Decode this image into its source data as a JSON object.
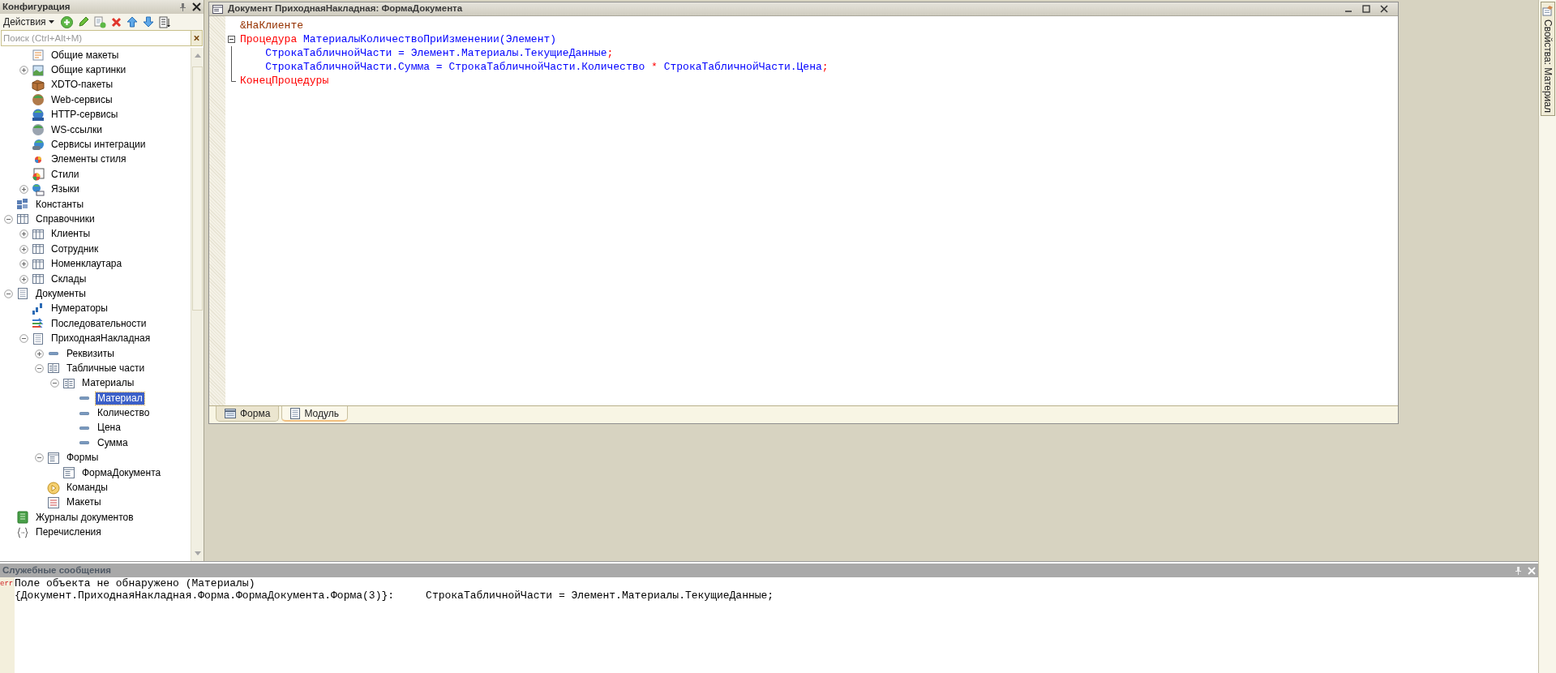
{
  "config_panel": {
    "title": "Конфигурация",
    "actions_menu": "Действия",
    "search": {
      "placeholder": "Поиск (Ctrl+Alt+M)"
    },
    "tree": {
      "continued": [
        {
          "label": "Общие макеты",
          "kind": "layouts",
          "selected": false
        },
        {
          "label": "Общие картинки",
          "kind": "pictures",
          "selected": false,
          "expanded": false
        },
        {
          "label": "XDTO-пакеты",
          "kind": "xdto",
          "selected": false
        },
        {
          "label": "Web-сервисы",
          "kind": "web",
          "selected": false
        },
        {
          "label": "HTTP-сервисы",
          "kind": "http",
          "selected": false
        },
        {
          "label": "WS-ссылки",
          "kind": "ws",
          "selected": false
        },
        {
          "label": "Сервисы интеграции",
          "kind": "integration",
          "selected": false
        },
        {
          "label": "Элементы стиля",
          "kind": "style-items",
          "selected": false
        },
        {
          "label": "Стили",
          "kind": "styles",
          "selected": false
        },
        {
          "label": "Языки",
          "kind": "languages",
          "selected": false,
          "expanded": false
        }
      ],
      "items": [
        {
          "label": "Константы",
          "kind": "constants",
          "selected": false
        },
        {
          "label": "Справочники",
          "kind": "catalogs",
          "selected": false,
          "expanded": true,
          "children": [
            {
              "label": "Клиенты",
              "kind": "catalog",
              "selected": false,
              "expanded": false
            },
            {
              "label": "Сотрудник",
              "kind": "catalog",
              "selected": false,
              "expanded": false
            },
            {
              "label": "Номенклаутара",
              "kind": "catalog",
              "selected": false,
              "expanded": false
            },
            {
              "label": "Склады",
              "kind": "catalog",
              "selected": false,
              "expanded": false
            }
          ]
        },
        {
          "label": "Документы",
          "kind": "documents",
          "selected": false,
          "expanded": true,
          "children": [
            {
              "label": "Нумераторы",
              "kind": "numerators",
              "selected": false
            },
            {
              "label": "Последовательности",
              "kind": "sequences",
              "selected": false
            },
            {
              "label": "ПриходнаяНакладная",
              "kind": "document",
              "selected": false,
              "expanded": true,
              "children": [
                {
                  "label": "Реквизиты",
                  "kind": "attributes",
                  "selected": false,
                  "expanded": false
                },
                {
                  "label": "Табличные части",
                  "kind": "tabular-sections",
                  "selected": false,
                  "expanded": true,
                  "children": [
                    {
                      "label": "Материалы",
                      "kind": "tabular-section",
                      "selected": false,
                      "expanded": true,
                      "children": [
                        {
                          "label": "Материал",
                          "kind": "attribute",
                          "selected": true
                        },
                        {
                          "label": "Количество",
                          "kind": "attribute",
                          "selected": false
                        },
                        {
                          "label": "Цена",
                          "kind": "attribute",
                          "selected": false
                        },
                        {
                          "label": "Сумма",
                          "kind": "attribute",
                          "selected": false
                        }
                      ]
                    }
                  ]
                },
                {
                  "label": "Формы",
                  "kind": "forms",
                  "selected": false,
                  "expanded": true,
                  "children": [
                    {
                      "label": "ФормаДокумента",
                      "kind": "form",
                      "selected": false
                    }
                  ]
                },
                {
                  "label": "Команды",
                  "kind": "commands",
                  "selected": false
                },
                {
                  "label": "Макеты",
                  "kind": "templates",
                  "selected": false
                }
              ]
            }
          ]
        },
        {
          "label": "Журналы документов",
          "kind": "journals",
          "selected": false
        },
        {
          "label": "Перечисления",
          "kind": "enums",
          "selected": false
        }
      ]
    }
  },
  "editor": {
    "title": "Документ ПриходнаяНакладная: ФормаДокумента",
    "code_lines": [
      {
        "kind": "line",
        "tokens": [
          {
            "kind": "directive",
            "text": "&НаКлиенте"
          }
        ]
      },
      {
        "kind": "block",
        "expanded": true,
        "lines": [
          {
            "tokens": [
              {
                "kind": "keyword",
                "text": "Процедура"
              },
              {
                "kind": "ident",
                "text": " МатериалыКоличествоПриИзменении(Элемент)"
              }
            ]
          },
          {
            "tokens": [
              {
                "kind": "ident",
                "text": "    СтрокаТабличнойЧасти = Элемент.Материалы.ТекущиеДанные"
              },
              {
                "kind": "operator",
                "text": ";"
              }
            ]
          },
          {
            "tokens": [
              {
                "kind": "ident",
                "text": "    СтрокаТабличнойЧасти.Сумма = СтрокаТабличнойЧасти.Количество "
              },
              {
                "kind": "operator",
                "text": "*"
              },
              {
                "kind": "ident",
                "text": " СтрокаТабличнойЧасти.Цена"
              },
              {
                "kind": "operator",
                "text": ";"
              }
            ]
          },
          {
            "tokens": [
              {
                "kind": "keyword",
                "text": "КонецПроцедуры"
              }
            ]
          }
        ]
      }
    ],
    "tabs": [
      {
        "label": "Форма",
        "kind": "form",
        "selected": false
      },
      {
        "label": "Модуль",
        "kind": "module",
        "selected": true
      }
    ]
  },
  "properties_tab": {
    "label": "Свойства: Материал"
  },
  "messages": {
    "title": "Служебные сообщения",
    "entries": [
      {
        "marker": "err",
        "text": "Поле объекта не обнаружено (Материалы)"
      },
      {
        "text": "{Документ.ПриходнаяНакладная.Форма.ФормаДокумента.Форма(3)}:     СтрокаТабличнойЧасти = Элемент.Материалы.ТекущиеДанные;"
      }
    ]
  }
}
